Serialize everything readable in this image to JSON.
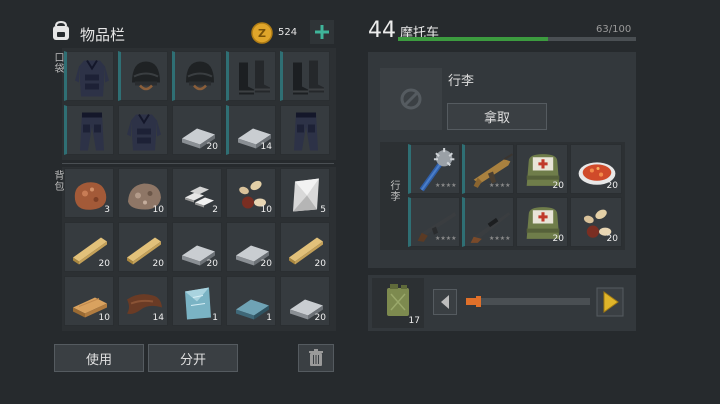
{
  "inventory": {
    "title": "物品栏",
    "coins": "524",
    "pocket_label": "口袋",
    "backpack_label": "背包",
    "use_label": "使用",
    "split_label": "分开",
    "pocket_slots": [
      {
        "icon": "body-armor-icon",
        "count": ""
      },
      {
        "icon": "helmet-icon",
        "count": ""
      },
      {
        "icon": "helmet-icon",
        "count": ""
      },
      {
        "icon": "boots-icon",
        "count": ""
      },
      {
        "icon": "boots-icon",
        "count": ""
      },
      {
        "icon": "armored-pants-icon",
        "count": ""
      },
      {
        "icon": "body-armor-icon",
        "count": ""
      },
      {
        "icon": "iron-bar-icon",
        "count": "20"
      },
      {
        "icon": "iron-bar-icon",
        "count": "14"
      },
      {
        "icon": "armored-pants-icon",
        "count": ""
      }
    ],
    "backpack_slots": [
      {
        "icon": "copper-ore-icon",
        "count": "3"
      },
      {
        "icon": "iron-ore-icon",
        "count": "10"
      },
      {
        "icon": "aluminum-bar-icon",
        "count": "2"
      },
      {
        "icon": "seeds-icon",
        "count": "10"
      },
      {
        "icon": "steel-plate-icon",
        "count": "5"
      },
      {
        "icon": "wood-plank-icon",
        "count": "20"
      },
      {
        "icon": "wood-plank-icon",
        "count": "20"
      },
      {
        "icon": "iron-bar-icon",
        "count": "20"
      },
      {
        "icon": "iron-bar-icon",
        "count": "20"
      },
      {
        "icon": "wood-plank-icon",
        "count": "20"
      },
      {
        "icon": "board-icon",
        "count": "10"
      },
      {
        "icon": "leather-icon",
        "count": "14"
      },
      {
        "icon": "glass-plate-icon",
        "count": "1"
      },
      {
        "icon": "steel-bar-icon",
        "count": "1"
      },
      {
        "icon": "iron-bar-icon",
        "count": "20"
      }
    ]
  },
  "vehicle": {
    "level": "44",
    "name": "摩托车",
    "capacity": "63/100",
    "capacity_fraction": 0.63,
    "luggage_title": "行李",
    "take_label": "拿取",
    "cargo_label": "行李",
    "cargo_slots": [
      {
        "icon": "spiked-club-icon",
        "count": ""
      },
      {
        "icon": "assault-rifle-icon",
        "count": ""
      },
      {
        "icon": "medkit-bag-icon",
        "count": "20"
      },
      {
        "icon": "cooked-meat-icon",
        "count": "20"
      },
      {
        "icon": "shotgun-icon",
        "count": ""
      },
      {
        "icon": "rifle-icon",
        "count": ""
      },
      {
        "icon": "medkit-bag-icon",
        "count": "20"
      },
      {
        "icon": "seeds-icon",
        "count": "20"
      }
    ],
    "fuel_count": "17",
    "fuel_fraction": 0.1
  },
  "colors": {
    "accent_teal": "#2f6f74",
    "coin_gold": "#e0a52a",
    "plus_green": "#3fb59a",
    "capacity_green": "#3c9b3f",
    "fuel_orange": "#e0702a",
    "arrow_yellow": "#e0b52a"
  }
}
